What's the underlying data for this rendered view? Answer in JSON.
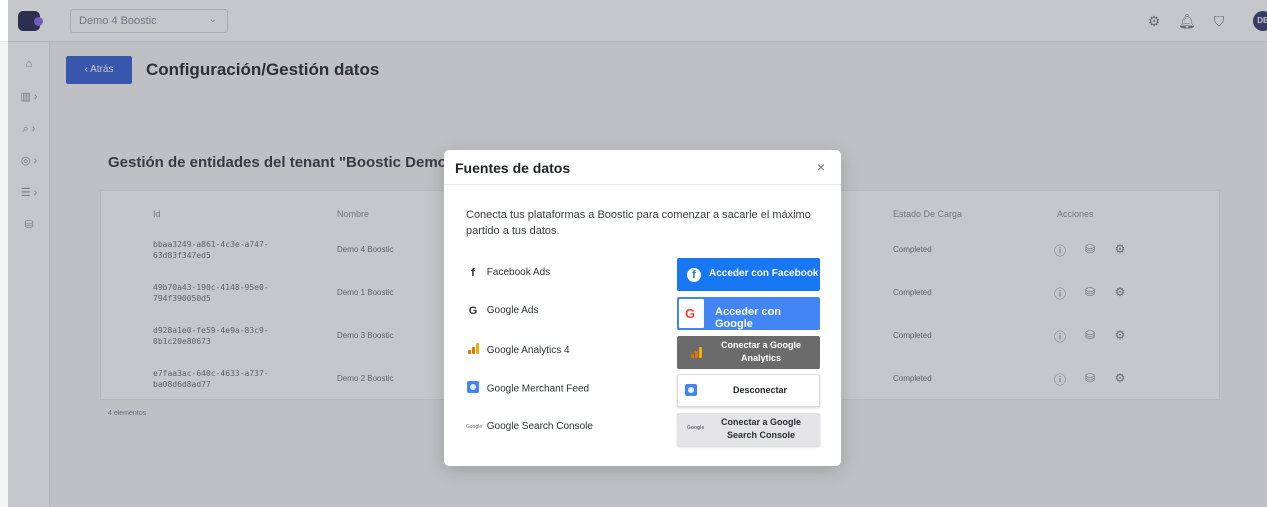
{
  "topbar": {
    "tenant_select": "Demo 4 Boostic",
    "avatar_initials": "DB",
    "icons": [
      "gear-icon",
      "bell-icon",
      "shield-icon"
    ]
  },
  "sidebar": {
    "icons": [
      "home-icon",
      "chart-icon",
      "search-icon",
      "target-icon",
      "list-icon",
      "database-icon"
    ]
  },
  "page": {
    "back_label": "‹ Atrás",
    "title": "Configuración/Gestión datos",
    "section_title": "Gestión de entidades del tenant \"Boostic Demo\""
  },
  "table": {
    "headers": {
      "id": "Id",
      "name": "Nombre",
      "state": "Estado De Carga",
      "actions": "Acciones"
    },
    "rows": [
      {
        "id": "bbaa3249-a861-4c3e-a747-63d83f347ed5",
        "name": "Demo 4 Boostic",
        "state": "Completed"
      },
      {
        "id": "49b70a43-190c-4148-95e0-794f390050d5",
        "name": "Demo 1 Boostic",
        "state": "Completed"
      },
      {
        "id": "d928a1e0-fe59-4e9a-83c9-0b1c20e80673",
        "name": "Demo 3 Boostic",
        "state": "Completed"
      },
      {
        "id": "e7faa3ac-640c-4633-a737-ba08d6d8ad77",
        "name": "Demo 2 Boostic",
        "state": "Completed"
      }
    ],
    "elements_count": "4 elementos"
  },
  "modal": {
    "title": "Fuentes de datos",
    "close_label": "×",
    "intro": "Conecta tus plataformas a Boostic para comenzar a sacarle el máximo partido a tus datos.",
    "sources": [
      {
        "label": "Facebook Ads",
        "icon": "facebook-icon",
        "button": "Acceder con Facebook"
      },
      {
        "label": "Google Ads",
        "icon": "google-icon",
        "button": "Acceder con Google"
      },
      {
        "label": "Google Analytics 4",
        "icon": "google-analytics-icon",
        "button": "Conectar a Google Analytics"
      },
      {
        "label": "Google Merchant Feed",
        "icon": "merchant-feed-icon",
        "button": "Desconectar"
      },
      {
        "label": "Google Search Console",
        "icon": "search-console-icon",
        "button": "Conectar a Google Search Console"
      }
    ],
    "glyphs": {
      "facebook": "f",
      "google": "G",
      "search_console": "Google"
    }
  },
  "colors": {
    "primary": "#3b63d6",
    "facebook": "#1877f2",
    "google": "#4285f4",
    "analytics_button": "#6b6b6b",
    "analytics_orange": "#f9ab00"
  }
}
